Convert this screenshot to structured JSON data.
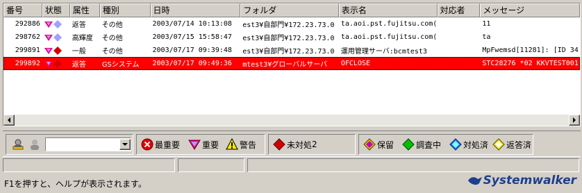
{
  "columns": [
    "番号",
    "状態",
    "属性",
    "種別",
    "日時",
    "フォルダ",
    "表示名",
    "対応者",
    "メッセージ"
  ],
  "rows": [
    {
      "num": "292886",
      "attr": "返答",
      "type": "その他",
      "date": "2003/07/14 10:13:08",
      "folder": "est3¥自部門¥172.23.73.0",
      "name": "ta.aoi.pst.fujitsu.com(",
      "handler": "",
      "msg": "11",
      "s1": "#e8007a",
      "s2": "#a0a0ff"
    },
    {
      "num": "298762",
      "attr": "高輝度",
      "type": "その他",
      "date": "2003/07/15 15:58:47",
      "folder": "est3¥自部門¥172.23.73.0",
      "name": "ta.aoi.pst.fujitsu.com(",
      "handler": "",
      "msg": "ta",
      "s1": "#e8007a",
      "s2": "#a0a0ff"
    },
    {
      "num": "299891",
      "attr": "一般",
      "type": "その他",
      "date": "2003/07/17 09:39:48",
      "folder": "est3¥自部門¥172.23.73.0",
      "name": "運用管理サーバ:bcmtest3",
      "handler": "",
      "msg": "MpFwemsd[11281]: [ID 34",
      "s1": "#e8007a",
      "s2": "#d40000"
    },
    {
      "num": "299892",
      "attr": "返答",
      "type": "GSシステム",
      "date": "2003/07/17 09:49:36",
      "folder": "mtest3¥グローバルサーバ",
      "name": "OFCLOSE",
      "handler": "",
      "msg": "STC28276 *02 KKVTEST001",
      "s1": "#e8007a",
      "s2": "#d40000"
    }
  ],
  "toolbar": {
    "combo_value": "",
    "critical": "最重要",
    "important": "重要",
    "warning": "警告",
    "unhandled": "未対処",
    "unhandled_count": "2",
    "pending": "保留",
    "investigating": "調査中",
    "handled": "対処済",
    "replied": "返答済"
  },
  "statusbar": {
    "help": "F1を押すと、ヘルプが表示されます。"
  },
  "brand": "Systemwalker",
  "colors": {
    "selected_row": "#ff0000",
    "brand": "#1e3f8c"
  }
}
